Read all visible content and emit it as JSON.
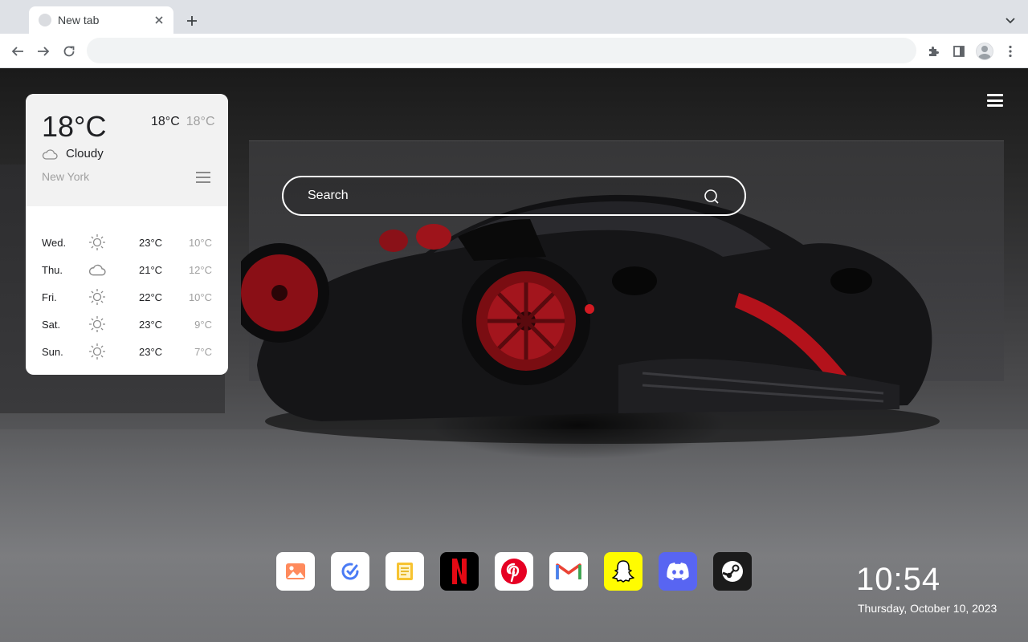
{
  "browser": {
    "tab_title": "New tab",
    "address_value": ""
  },
  "weather": {
    "current_temp": "18°C",
    "high": "18°C",
    "low": "18°C",
    "condition": "Cloudy",
    "city": "New York",
    "forecast": [
      {
        "day": "Wed.",
        "icon": "sun-icon",
        "high": "23°C",
        "low": "10°C"
      },
      {
        "day": "Thu.",
        "icon": "cloud-icon",
        "high": "21°C",
        "low": "12°C"
      },
      {
        "day": "Fri.",
        "icon": "sun-icon",
        "high": "22°C",
        "low": "10°C"
      },
      {
        "day": "Sat.",
        "icon": "sun-icon",
        "high": "23°C",
        "low": "9°C"
      },
      {
        "day": "Sun.",
        "icon": "sun-icon",
        "high": "23°C",
        "low": "7°C"
      }
    ]
  },
  "search": {
    "placeholder": "Search"
  },
  "dock": [
    {
      "name": "gallery-app",
      "icon": "image-icon",
      "bg": "#ffffff"
    },
    {
      "name": "tasks-app",
      "icon": "check-icon",
      "bg": "#ffffff"
    },
    {
      "name": "notes-app",
      "icon": "note-icon",
      "bg": "#ffffff"
    },
    {
      "name": "netflix-app",
      "icon": "netflix-icon",
      "bg": "#000000"
    },
    {
      "name": "pinterest-app",
      "icon": "pinterest-icon",
      "bg": "#ffffff"
    },
    {
      "name": "gmail-app",
      "icon": "gmail-icon",
      "bg": "#ffffff"
    },
    {
      "name": "snapchat-app",
      "icon": "snapchat-icon",
      "bg": "#fffc00"
    },
    {
      "name": "discord-app",
      "icon": "discord-icon",
      "bg": "#5865f2"
    },
    {
      "name": "steam-app",
      "icon": "steam-icon",
      "bg": "#1b1b1b"
    }
  ],
  "clock": {
    "time": "10:54",
    "date": "Thursday, October 10, 2023"
  },
  "colors": {
    "netflix_red": "#e50914",
    "pinterest_red": "#e60023",
    "snapchat_yellow": "#fffc00",
    "discord_blurple": "#5865f2"
  }
}
